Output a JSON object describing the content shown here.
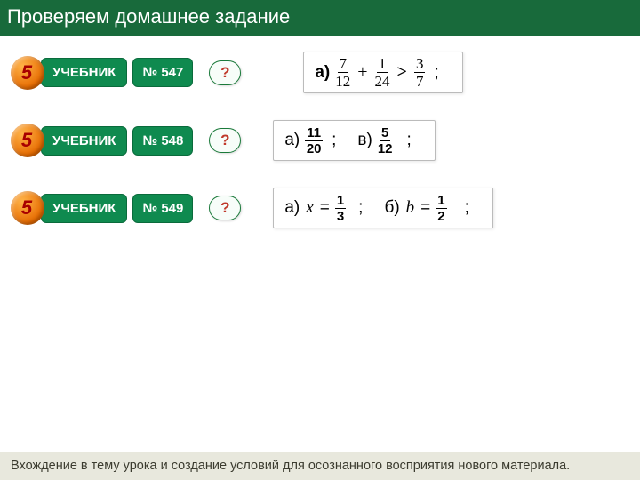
{
  "header": "Проверяем домашнее задание",
  "rows": [
    {
      "medal": "5",
      "chip": "УЧЕБНИК",
      "num": "№ 547",
      "q": "?",
      "a": {
        "label": "а)",
        "f1": {
          "n": "7",
          "d": "12"
        },
        "plus": "+",
        "f2": {
          "n": "1",
          "d": "24"
        },
        "cmp": ">",
        "f3": {
          "n": "3",
          "d": "7"
        },
        "semi": ";"
      }
    },
    {
      "medal": "5",
      "chip": "УЧЕБНИК",
      "num": "№ 548",
      "q": "?",
      "a": {
        "p1": "а)",
        "f1": {
          "n": "11",
          "d": "20"
        },
        "s1": ";",
        "p2": "в)",
        "f2": {
          "n": "5",
          "d": "12"
        },
        "s2": ";"
      }
    },
    {
      "medal": "5",
      "chip": "УЧЕБНИК",
      "num": "№ 549",
      "q": "?",
      "a": {
        "p1": "а)",
        "v1": "x",
        "eq": "=",
        "f1": {
          "n": "1",
          "d": "3"
        },
        "s1": ";",
        "p2": "б)",
        "v2": "b",
        "f2": {
          "n": "1",
          "d": "2"
        },
        "s2": ";"
      }
    }
  ],
  "footer": "Вхождение в тему урока и создание условий для осознанного восприятия нового материала."
}
